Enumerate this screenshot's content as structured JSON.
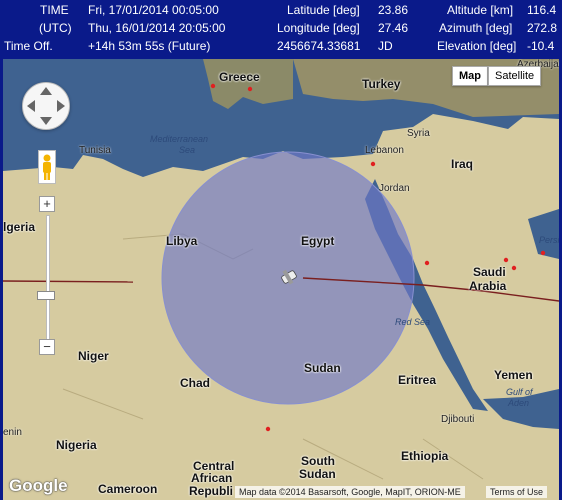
{
  "header": {
    "time_label": "TIME",
    "time_value": "Fri, 17/01/2014 00:05:00",
    "utc_label": "(UTC)",
    "utc_value": "Thu, 16/01/2014 20:05:00",
    "offset_label": "Time Off.",
    "offset_value": "+14h 53m 55s (Future)",
    "latitude_label": "Latitude [deg]",
    "latitude_value": "23.86",
    "longitude_label": "Longitude [deg]",
    "longitude_value": "27.46",
    "jd_value": "2456674.33681",
    "jd_label": "JD",
    "altitude_label": "Altitude [km]",
    "altitude_value": "116.4",
    "azimuth_label": "Azimuth [deg]",
    "azimuth_value": "272.8",
    "elevation_label": "Elevation [deg]",
    "elevation_value": "-10.4"
  },
  "map": {
    "type_map": "Map",
    "type_satellite": "Satellite",
    "zoom_in": "+",
    "zoom_out": "−",
    "zoom_level_fraction": 0.38,
    "attribution": "Map data ©2014 Basarsoft, Google, MapIT, ORION-ME",
    "terms": "Terms of Use",
    "google_logo": "Google",
    "labels": {
      "greece": "Greece",
      "turkey": "Turkey",
      "mediterranean": "Mediterranean",
      "sea": "Sea",
      "tunisia": "Tunisia",
      "syria": "Syria",
      "lebanon": "Lebanon",
      "iraq": "Iraq",
      "jordan": "Jordan",
      "azerbaijan": "Azerbaijan",
      "algeria": "lgeria",
      "libya": "Libya",
      "egypt": "Egypt",
      "persia": "Persi",
      "saudi": "Saudi",
      "arabia": "Arabia",
      "red_sea": "Red Sea",
      "niger": "Niger",
      "chad": "Chad",
      "sudan": "Sudan",
      "eritrea": "Eritrea",
      "yemen": "Yemen",
      "gulf": "Gulf of",
      "aden": "Aden",
      "djibouti": "Djibouti",
      "benin": "enin",
      "nigeria": "Nigeria",
      "central": "Central",
      "african": "African",
      "republic": "Republi",
      "south": "South",
      "sudan2": "Sudan",
      "ethiopia": "Ethiopia",
      "cameroon": "Cameroon"
    },
    "colors": {
      "footprint_fill": "#6e78c8",
      "track": "#7a1f1f",
      "station": "#e02020",
      "land": "#d8cda3",
      "water": "#3c5e8e"
    }
  }
}
